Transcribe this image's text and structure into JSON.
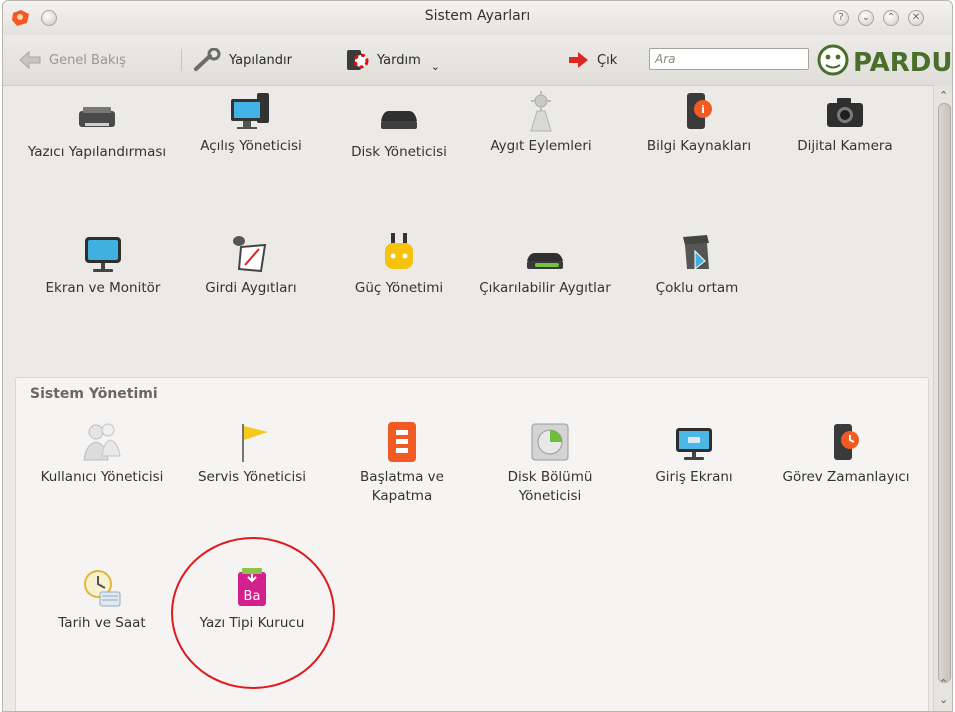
{
  "window": {
    "title": "Sistem Ayarları"
  },
  "toolbar": {
    "overview_label": "Genel Bakış",
    "configure_label": "Yapılandır",
    "help_label": "Yardım",
    "quit_label": "Çık",
    "search_placeholder": "Ara",
    "brand_text": "PARDUS"
  },
  "hardware_items": [
    {
      "label": "Yazıcı Yapılandırması",
      "icon": "printer-icon"
    },
    {
      "label": "Açılış Yöneticisi",
      "icon": "monitor-computer-icon"
    },
    {
      "label": "Disk Yöneticisi",
      "icon": "hard-disk-icon"
    },
    {
      "label": "Aygıt Eylemleri",
      "icon": "device-actions-icon"
    },
    {
      "label": "Bilgi Kaynakları",
      "icon": "info-sources-icon"
    },
    {
      "label": "Dijital Kamera",
      "icon": "camera-icon"
    },
    {
      "label": "Ekran ve Monitör",
      "icon": "display-icon"
    },
    {
      "label": "Girdi Aygıtları",
      "icon": "input-devices-icon"
    },
    {
      "label": "Güç Yönetimi",
      "icon": "power-plug-icon"
    },
    {
      "label": "Çıkarılabilir Aygıtlar",
      "icon": "removable-drive-icon"
    },
    {
      "label": "Çoklu ortam",
      "icon": "multimedia-icon"
    }
  ],
  "system_section": {
    "title": "Sistem Yönetimi",
    "items": [
      {
        "label": "Kullanıcı Yöneticisi",
        "icon": "users-icon"
      },
      {
        "label": "Servis Yöneticisi",
        "icon": "flag-icon"
      },
      {
        "label": "Başlatma ve Kapatma",
        "icon": "startup-icon"
      },
      {
        "label": "Disk Bölümü Yöneticisi",
        "icon": "partition-icon"
      },
      {
        "label": "Giriş Ekranı",
        "icon": "login-screen-icon"
      },
      {
        "label": "Görev Zamanlayıcı",
        "icon": "task-scheduler-icon"
      },
      {
        "label": "Tarih ve Saat",
        "icon": "clock-icon"
      },
      {
        "label": "Yazı Tipi Kurucu",
        "icon": "font-installer-icon"
      }
    ]
  },
  "colors": {
    "highlight": "#e1191b",
    "accent_orange": "#f15a22",
    "pardus_green": "#4a6f2a"
  }
}
